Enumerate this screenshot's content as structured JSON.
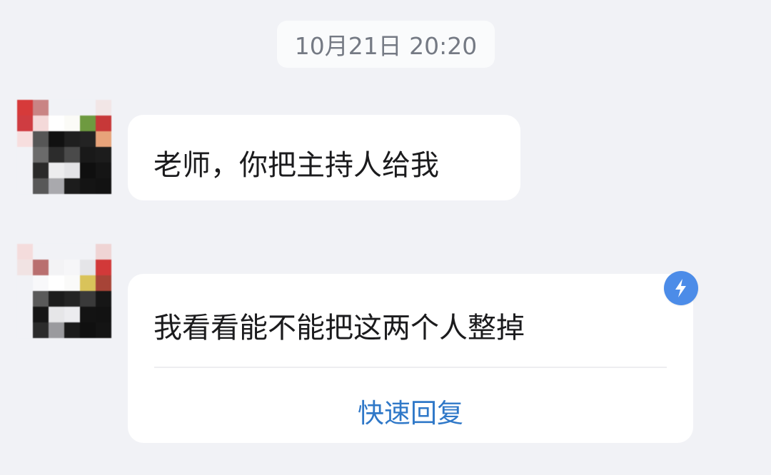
{
  "timestamp": "10月21日 20:20",
  "messages": [
    {
      "text": "老师，你把主持人给我",
      "avatar": "pixelated-avatar"
    },
    {
      "text": "我看看能不能把这两个人整掉",
      "avatar": "pixelated-avatar",
      "action_label": "快速回复",
      "badge_icon": "lightning-icon"
    }
  ],
  "colors": {
    "background": "#f1f2f6",
    "bubble": "#ffffff",
    "timestamp_text": "#757a84",
    "message_text": "#1b1b1d",
    "quick_reply_text": "#2f78c8",
    "badge": "#4c8ce8"
  }
}
